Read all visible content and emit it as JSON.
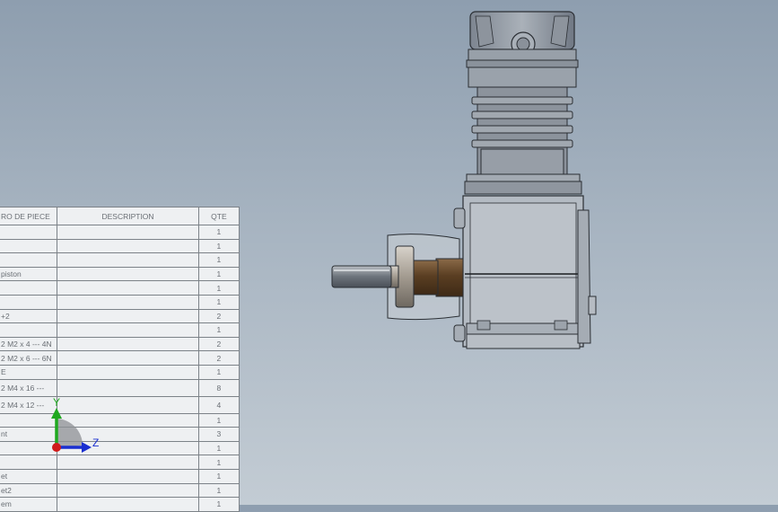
{
  "bom": {
    "headers": {
      "part": "RO DE PIECE",
      "description": "DESCRIPTION",
      "qty": "QTE"
    },
    "rows": [
      {
        "part": "",
        "description": "",
        "qty": "1"
      },
      {
        "part": "",
        "description": "",
        "qty": "1"
      },
      {
        "part": "",
        "description": "",
        "qty": "1"
      },
      {
        "part": "piston",
        "description": "",
        "qty": "1"
      },
      {
        "part": "",
        "description": "",
        "qty": "1"
      },
      {
        "part": "",
        "description": "",
        "qty": "1"
      },
      {
        "part": "+2",
        "description": "",
        "qty": "2"
      },
      {
        "part": "",
        "description": "",
        "qty": "1"
      },
      {
        "part": "2 M2 x 4 --- 4N",
        "description": "",
        "qty": "2"
      },
      {
        "part": "2 M2 x 6 --- 6N",
        "description": "",
        "qty": "2"
      },
      {
        "part": "E",
        "description": "",
        "qty": "1"
      },
      {
        "part": "2 M4 x 16 ---",
        "description": "",
        "qty": "8"
      },
      {
        "part": "2 M4 x 12 ---",
        "description": "",
        "qty": "4"
      },
      {
        "part": "",
        "description": "",
        "qty": "1"
      },
      {
        "part": "nt",
        "description": "",
        "qty": "3"
      },
      {
        "part": "",
        "description": "",
        "qty": "1"
      },
      {
        "part": "",
        "description": "",
        "qty": "1"
      },
      {
        "part": "et",
        "description": "",
        "qty": "1"
      },
      {
        "part": "et2",
        "description": "",
        "qty": "1"
      },
      {
        "part": "em",
        "description": "",
        "qty": "1"
      }
    ]
  },
  "triad": {
    "y_label": "Y",
    "z_label": "Z",
    "y_color": "#1fa81f",
    "z_color": "#1a2fd0",
    "x_color": "#d01a1a"
  },
  "model": {
    "name": "engine-assembly"
  }
}
